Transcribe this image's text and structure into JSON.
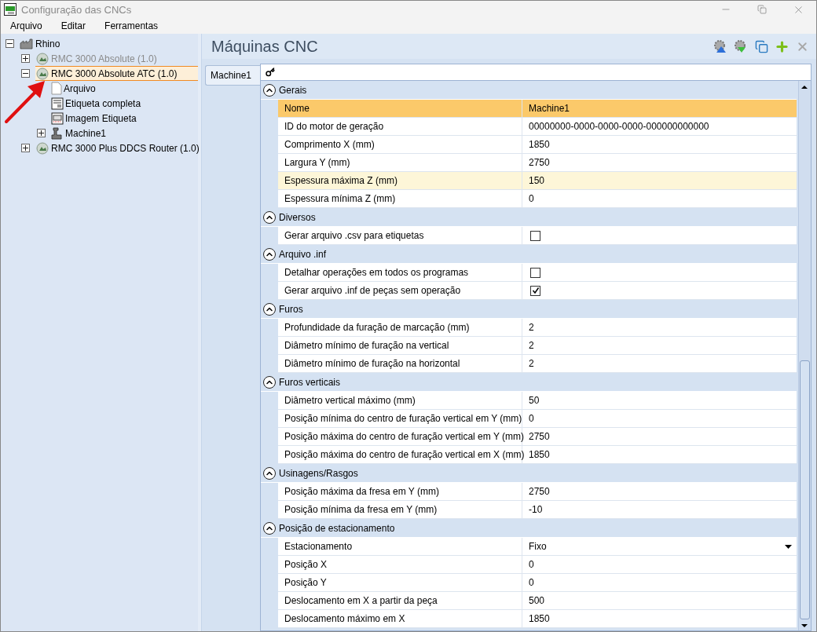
{
  "window": {
    "title": "Configuração das CNCs"
  },
  "menu": [
    "Arquivo",
    "Editar",
    "Ferramentas"
  ],
  "tree": [
    {
      "label": "Rhino",
      "kind": "group",
      "expanded": true,
      "selected": false,
      "disabled": false,
      "children": [
        {
          "label": "RMC 3000 Absolute (1.0)",
          "kind": "cnc",
          "expanded": false,
          "selected": false,
          "disabled": true
        },
        {
          "label": "RMC 3000 Absolute ATC (1.0)",
          "kind": "cnc",
          "expanded": true,
          "selected": true,
          "disabled": false,
          "children": [
            {
              "label": "Arquivo",
              "kind": "file",
              "selected": false,
              "disabled": false
            },
            {
              "label": "Etiqueta completa",
              "kind": "label",
              "selected": false,
              "disabled": false
            },
            {
              "label": "Imagem Etiqueta",
              "kind": "image",
              "selected": false,
              "disabled": false
            },
            {
              "label": "Machine1",
              "kind": "machine",
              "expanded": false,
              "selected": false,
              "disabled": false
            }
          ]
        },
        {
          "label": "RMC 3000 Plus DDCS Router (1.0)",
          "kind": "cnc",
          "expanded": false,
          "selected": false,
          "disabled": false
        }
      ]
    }
  ],
  "panel": {
    "title": "Máquinas CNC"
  },
  "tabs": [
    {
      "label": "Machine1",
      "selected": true
    }
  ],
  "sections": [
    {
      "title": "Gerais",
      "expanded": true,
      "rows": [
        {
          "label": "Nome",
          "kind": "text",
          "value": "Machine1",
          "selected": true,
          "hovered": false
        },
        {
          "label": "ID do motor de geração",
          "kind": "text",
          "value": "00000000-0000-0000-0000-000000000000",
          "selected": false,
          "hovered": false
        },
        {
          "label": "Comprimento X (mm)",
          "kind": "text",
          "value": "1850",
          "selected": false,
          "hovered": false
        },
        {
          "label": "Largura Y (mm)",
          "kind": "text",
          "value": "2750",
          "selected": false,
          "hovered": false
        },
        {
          "label": "Espessura máxima Z (mm)",
          "kind": "text",
          "value": "150",
          "selected": false,
          "hovered": true
        },
        {
          "label": "Espessura mínima Z (mm)",
          "kind": "text",
          "value": "0",
          "selected": false,
          "hovered": false
        }
      ]
    },
    {
      "title": "Diversos",
      "expanded": true,
      "rows": [
        {
          "label": "Gerar arquivo .csv para etiquetas",
          "kind": "checkbox",
          "checked": false,
          "selected": false,
          "hovered": false
        }
      ]
    },
    {
      "title": "Arquivo .inf",
      "expanded": true,
      "rows": [
        {
          "label": "Detalhar operações em todos os programas",
          "kind": "checkbox",
          "checked": false,
          "selected": false,
          "hovered": false
        },
        {
          "label": "Gerar arquivo .inf de peças sem operação",
          "kind": "checkbox",
          "checked": true,
          "selected": false,
          "hovered": false
        }
      ]
    },
    {
      "title": "Furos",
      "expanded": true,
      "rows": [
        {
          "label": "Profundidade da furação de marcação (mm)",
          "kind": "text",
          "value": "2",
          "selected": false,
          "hovered": false
        },
        {
          "label": "Diâmetro mínimo de furação na vertical",
          "kind": "text",
          "value": "2",
          "selected": false,
          "hovered": false
        },
        {
          "label": "Diâmetro mínimo de furação na horizontal",
          "kind": "text",
          "value": "2",
          "selected": false,
          "hovered": false
        }
      ]
    },
    {
      "title": "Furos verticais",
      "expanded": true,
      "rows": [
        {
          "label": "Diâmetro vertical máximo (mm)",
          "kind": "text",
          "value": "50",
          "selected": false,
          "hovered": false
        },
        {
          "label": "Posição mínima do centro de furação vertical em Y (mm)",
          "kind": "text",
          "value": "0",
          "selected": false,
          "hovered": false
        },
        {
          "label": "Posição máxima do centro de furação vertical em Y (mm)",
          "kind": "text",
          "value": "2750",
          "selected": false,
          "hovered": false
        },
        {
          "label": "Posição máxima do centro de furação vertical em X (mm)",
          "kind": "text",
          "value": "1850",
          "selected": false,
          "hovered": false
        }
      ]
    },
    {
      "title": "Usinagens/Rasgos",
      "expanded": true,
      "rows": [
        {
          "label": "Posição máxima da fresa em Y (mm)",
          "kind": "text",
          "value": "2750",
          "selected": false,
          "hovered": false
        },
        {
          "label": "Posição mínima da fresa em Y (mm)",
          "kind": "text",
          "value": "-10",
          "selected": false,
          "hovered": false
        }
      ]
    },
    {
      "title": "Posição de estacionamento",
      "expanded": true,
      "rows": [
        {
          "label": "Estacionamento",
          "kind": "dropdown",
          "value": "Fixo",
          "selected": false,
          "hovered": false
        },
        {
          "label": "Posição X",
          "kind": "text",
          "value": "0",
          "selected": false,
          "hovered": false
        },
        {
          "label": "Posição Y",
          "kind": "text",
          "value": "0",
          "selected": false,
          "hovered": false
        },
        {
          "label": "Deslocamento em X a partir da peça",
          "kind": "text",
          "value": "500",
          "selected": false,
          "hovered": false
        },
        {
          "label": "Deslocamento máximo em X",
          "kind": "text",
          "value": "1850",
          "selected": false,
          "hovered": false
        }
      ]
    }
  ]
}
